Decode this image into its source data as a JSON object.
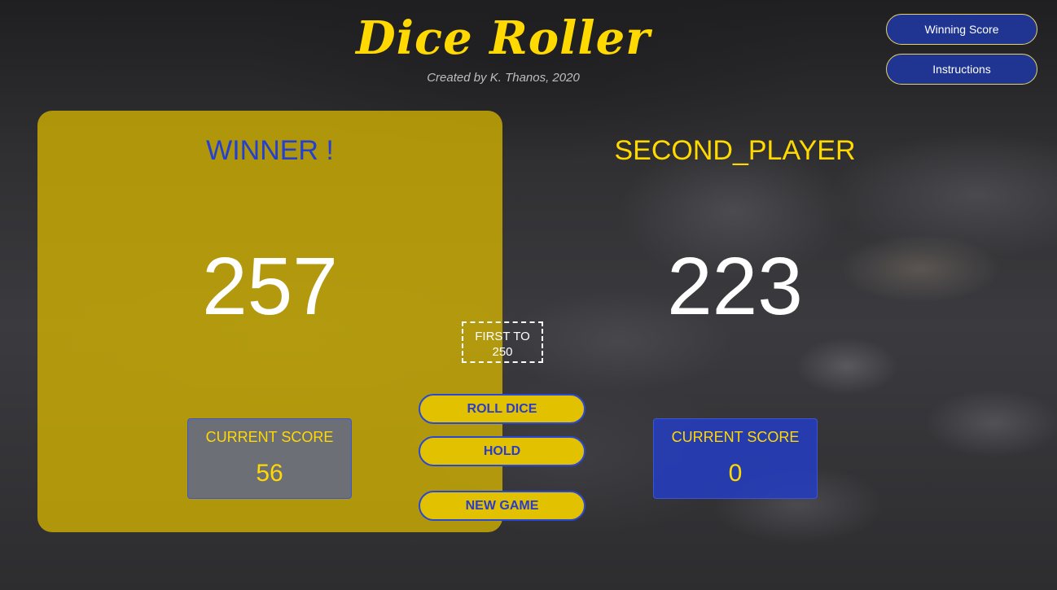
{
  "header": {
    "title": "Dice Roller",
    "subtitle": "Created by K. Thanos, 2020"
  },
  "top_buttons": {
    "winning_score": "Winning Score",
    "instructions": "Instructions"
  },
  "player1": {
    "name": "WINNER !",
    "total_score": "257",
    "current_label": "CURRENT SCORE",
    "current_score": "56"
  },
  "player2": {
    "name": "SECOND_PLAYER",
    "total_score": "223",
    "current_label": "CURRENT SCORE",
    "current_score": "0"
  },
  "goal": {
    "line1": "FIRST TO",
    "value": "250"
  },
  "actions": {
    "roll": "ROLL DICE",
    "hold": "HOLD",
    "new_game": "NEW GAME"
  },
  "colors": {
    "accent_yellow": "#ffd900",
    "accent_blue": "#2340d0",
    "active_panel": "#d4b400"
  }
}
